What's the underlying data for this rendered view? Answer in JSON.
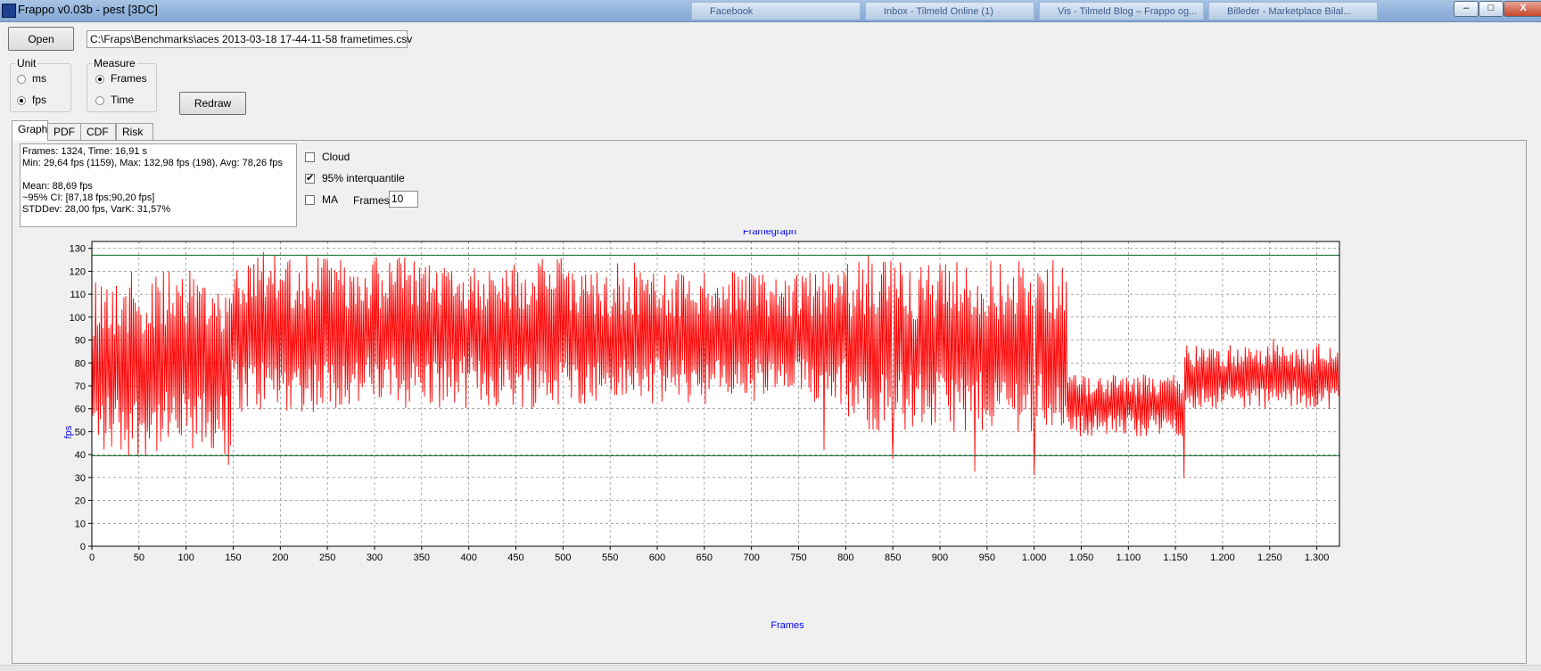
{
  "window": {
    "title": "Frappo v0.03b - pest [3DC]",
    "background_tabs": [
      "Facebook",
      "Inbox - Tilmeld Online (1)",
      "Vis - Tilmeld Blog – Frappo og...",
      "Billeder - Marketplace Bilal..."
    ],
    "minimize": "–",
    "maximize": "□",
    "close": "X"
  },
  "toolbar": {
    "open_label": "Open",
    "path_value": "C:\\Fraps\\Benchmarks\\aces 2013-03-18 17-44-11-58 frametimes.csv",
    "redraw_label": "Redraw"
  },
  "unit": {
    "title": "Unit",
    "options": [
      "ms",
      "fps"
    ],
    "selected": "fps"
  },
  "measure": {
    "title": "Measure",
    "options": [
      "Frames",
      "Time"
    ],
    "selected": "Frames"
  },
  "tabs": [
    "Graph",
    "PDF",
    "CDF",
    "Risk"
  ],
  "active_tab": "Graph",
  "stats": {
    "line1": "Frames: 1324, Time: 16,91 s",
    "line2": "Min: 29,64 fps (1159), Max: 132,98 fps (198), Avg: 78,26 fps",
    "line3": "Mean: 88,69 fps",
    "line4": "~95% CI: [87,18 fps;90,20 fps]",
    "line5": "STDDev: 28,00 fps, VarK: 31,57%"
  },
  "options": {
    "cloud_label": "Cloud",
    "cloud_checked": false,
    "interquantile_label": "95% interquantile",
    "interquantile_checked": true,
    "ma_label": "MA",
    "ma_checked": false,
    "frames_label": "Frames:",
    "frames_value": "10"
  },
  "colors": {
    "series": "#ff0000",
    "band": "#1f7a3a",
    "title_text": "#0000ff"
  },
  "chart_data": {
    "type": "line",
    "title": "Framegraph",
    "xlabel": "Frames",
    "ylabel": "fps",
    "xlim": [
      0,
      1324
    ],
    "ylim": [
      0,
      133
    ],
    "xticks": [
      0,
      50,
      100,
      150,
      200,
      250,
      300,
      350,
      400,
      450,
      500,
      550,
      600,
      650,
      700,
      750,
      800,
      850,
      900,
      950,
      1000,
      1050,
      1100,
      1150,
      1200,
      1250,
      1300
    ],
    "xtick_labels": [
      "0",
      "50",
      "100",
      "150",
      "200",
      "250",
      "300",
      "350",
      "400",
      "450",
      "500",
      "550",
      "600",
      "650",
      "700",
      "750",
      "800",
      "850",
      "900",
      "950",
      "1.000",
      "1.050",
      "1.100",
      "1.150",
      "1.200",
      "1.250",
      "1.300"
    ],
    "yticks": [
      0,
      10,
      20,
      30,
      40,
      50,
      60,
      70,
      80,
      90,
      100,
      110,
      120,
      130
    ],
    "grid": true,
    "interquantile_band": [
      39.5,
      127
    ],
    "series": [
      {
        "segments": [
          {
            "x": [
              0,
              148
            ],
            "low": 39,
            "high": 120,
            "peak": 130
          },
          {
            "x": [
              148,
              250
            ],
            "low": 58,
            "high": 128,
            "peak": 133
          },
          {
            "x": [
              250,
              500
            ],
            "low": 60,
            "high": 126,
            "peak": 130
          },
          {
            "x": [
              500,
              800
            ],
            "low": 62,
            "high": 120,
            "peak": 127
          },
          {
            "x": [
              800,
              1035
            ],
            "low": 50,
            "high": 125,
            "peak": 128
          },
          {
            "x": [
              1035,
              1160
            ],
            "low": 48,
            "high": 75,
            "peak": 80
          },
          {
            "x": [
              1160,
              1324
            ],
            "low": 60,
            "high": 88,
            "peak": 91
          }
        ],
        "dips": [
          [
            145,
            35.5
          ],
          [
            777,
            42
          ],
          [
            850,
            38
          ],
          [
            937,
            32.5
          ],
          [
            1000,
            31
          ],
          [
            1159,
            29.64
          ]
        ]
      }
    ]
  }
}
